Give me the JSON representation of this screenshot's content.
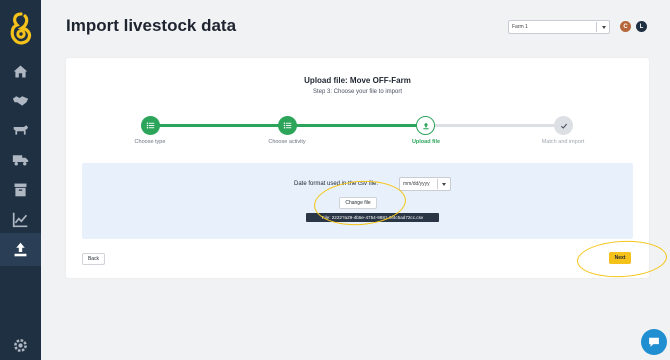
{
  "header": {
    "title": "Import livestock data"
  },
  "farm_select": {
    "value": "Farm 1"
  },
  "avatars": [
    {
      "letter": "C",
      "color": "#b5663b"
    },
    {
      "letter": "L",
      "color": "#1f3042"
    }
  ],
  "sidebar": {
    "items": [
      {
        "icon": "home-icon"
      },
      {
        "icon": "handshake-icon"
      },
      {
        "icon": "cow-icon"
      },
      {
        "icon": "truck-icon"
      },
      {
        "icon": "archive-icon"
      },
      {
        "icon": "chart-line-icon"
      },
      {
        "icon": "upload-icon",
        "active": true
      }
    ],
    "footer_icon": "gear-icon"
  },
  "card": {
    "title": "Upload file: Move OFF-Farm",
    "subtitle": "Step 3: Choose your file to import"
  },
  "steps": [
    {
      "label": "Choose type",
      "state": "done"
    },
    {
      "label": "Choose activity",
      "state": "done"
    },
    {
      "label": "Upload file",
      "state": "current"
    },
    {
      "label": "Match and import",
      "state": "pending"
    }
  ],
  "upload": {
    "date_format_label": "Date format used in the csv file:",
    "date_format_value": "mm/dd/yyyy",
    "change_file_label": "Change file",
    "file_name": "File: 2222?a29-4b5e-4754-9881-0f4c5ad72cc.csv"
  },
  "buttons": {
    "back": "Back",
    "next": "Next"
  },
  "colors": {
    "sidebar": "#1f3042",
    "accent_green": "#2ca55a",
    "accent_yellow": "#f4c21a",
    "upload_bg": "#e8f1fb"
  }
}
